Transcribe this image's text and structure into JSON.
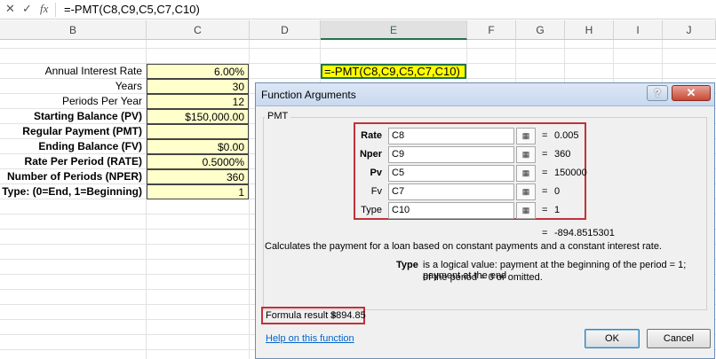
{
  "formula_bar": {
    "cancel_icon": "close-icon",
    "enter_icon": "check-icon",
    "fx_label": "fx",
    "formula": "=-PMT(C8,C9,C5,C7,C10)"
  },
  "columns": [
    "B",
    "C",
    "D",
    "E",
    "F",
    "G",
    "H",
    "I",
    "J"
  ],
  "sheet": {
    "rows": [
      {
        "label": "Annual Interest Rate",
        "value": "6.00%",
        "bold": false
      },
      {
        "label": "Years",
        "value": "30",
        "bold": false
      },
      {
        "label": "Periods Per Year",
        "value": "12",
        "bold": false
      },
      {
        "label": "Starting Balance (PV)",
        "value": "$150,000.00",
        "bold": true
      },
      {
        "label": "Regular Payment (PMT)",
        "value": "",
        "bold": true
      },
      {
        "label": "Ending Balance (FV)",
        "value": "$0.00",
        "bold": true
      },
      {
        "label": "Rate Per Period (RATE)",
        "value": "0.5000%",
        "bold": true
      },
      {
        "label": "Number of Periods (NPER)",
        "value": "360",
        "bold": true
      },
      {
        "label": "Type: (0=End, 1=Beginning)",
        "value": "1",
        "bold": true
      }
    ],
    "e_cell": "=-PMT(C8,C9,C5,C7,C10)"
  },
  "dialog": {
    "title": "Function Arguments",
    "help_btn": "?",
    "close_btn": "✕",
    "function_name": "PMT",
    "args": [
      {
        "label": "Rate",
        "input": "C8",
        "value": "0.005",
        "bold": true
      },
      {
        "label": "Nper",
        "input": "C9",
        "value": "360",
        "bold": true
      },
      {
        "label": "Pv",
        "input": "C5",
        "value": "150000",
        "bold": true
      },
      {
        "label": "Fv",
        "input": "C7",
        "value": "0",
        "bold": false
      },
      {
        "label": "Type",
        "input": "C10",
        "value": "1",
        "bold": false
      }
    ],
    "ref_icon": "collapse-dialog-icon",
    "eq": "=",
    "result_value": "-894.8515301",
    "description": "Calculates the payment for a loan based on constant payments and a constant interest rate.",
    "arg_name": "Type",
    "arg_desc_1": "is a logical value: payment at the beginning of the period = 1; payment at the end",
    "arg_desc_2": "of the period = 0 or omitted.",
    "formula_result_label": "Formula result =",
    "formula_result_value": "$894.85",
    "help_link": "Help on this function",
    "ok": "OK",
    "cancel": "Cancel"
  }
}
